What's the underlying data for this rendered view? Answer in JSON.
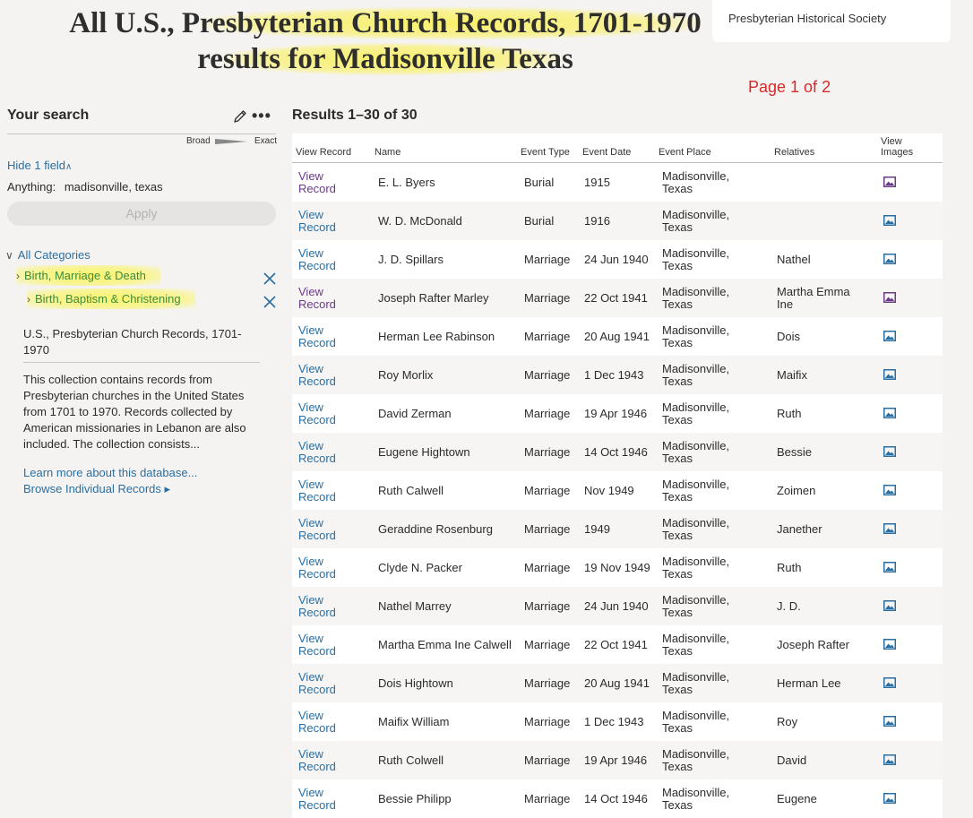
{
  "title": {
    "line1_pre": "All U.S., P",
    "line1_hl": "resbyterian Church Records, 1701-1970",
    "line2_pre": "re",
    "line2_hl": "sults for Madisonville Texa",
    "line2_post": "s"
  },
  "source": "Presbyterian Historical Society",
  "page_indicator": "Page 1 of 2",
  "sidebar": {
    "heading": "Your search",
    "slider_broad": "Broad",
    "slider_exact": "Exact",
    "hide_fields": "Hide 1 field",
    "anything_label": "Anything:",
    "anything_value": "madisonville, texas",
    "apply_label": "Apply",
    "all_categories": "All Categories",
    "category_1": "Birth, Marriage & Death",
    "category_2": "Birth, Baptism & Christening",
    "collection_title": "U.S., Presbyterian Church Records, 1701-1970",
    "collection_desc": "This collection contains records from Presbyterian churches in the United States from 1701 to 1970. Records collected by American missionaries in Lebanon are also included. The collection consists...",
    "learn_more": "Learn more about this database...",
    "browse": "Browse Individual Records ▸"
  },
  "results": {
    "heading": "Results 1–30 of 30",
    "columns": {
      "view_record": "View Record",
      "name": "Name",
      "event_type": "Event Type",
      "event_date": "Event Date",
      "event_place": "Event Place",
      "relatives": "Relatives",
      "view_images_1": "View",
      "view_images_2": "Images"
    },
    "view_line1": "View",
    "view_line2": "Record",
    "place_line1": "Madisonville,",
    "place_line2": "Texas",
    "rows": [
      {
        "name": "E. L. Byers",
        "type": "Burial",
        "date": "1915",
        "relatives": "",
        "visited": true
      },
      {
        "name": "W. D. McDonald",
        "type": "Burial",
        "date": "1916",
        "relatives": "",
        "visited": false
      },
      {
        "name": "J. D. Spillars",
        "type": "Marriage",
        "date": "24 Jun 1940",
        "relatives": "Nathel",
        "visited": false
      },
      {
        "name": "Joseph Rafter Marley",
        "type": "Marriage",
        "date": "22 Oct 1941",
        "relatives": "Martha Emma Ine",
        "visited": true
      },
      {
        "name": "Herman Lee Rabinson",
        "type": "Marriage",
        "date": "20 Aug 1941",
        "relatives": "Dois",
        "visited": false
      },
      {
        "name": "Roy Morlix",
        "type": "Marriage",
        "date": "1 Dec 1943",
        "relatives": "Maifix",
        "visited": false
      },
      {
        "name": "David Zerman",
        "type": "Marriage",
        "date": "19 Apr 1946",
        "relatives": "Ruth",
        "visited": false
      },
      {
        "name": "Eugene Hightown",
        "type": "Marriage",
        "date": "14 Oct 1946",
        "relatives": "Bessie",
        "visited": false
      },
      {
        "name": "Ruth Calwell",
        "type": "Marriage",
        "date": "Nov 1949",
        "relatives": "Zoimen",
        "visited": false
      },
      {
        "name": "Geraddine Rosenburg",
        "type": "Marriage",
        "date": "1949",
        "relatives": "Janether",
        "visited": false
      },
      {
        "name": "Clyde N. Packer",
        "type": "Marriage",
        "date": "19 Nov 1949",
        "relatives": "Ruth",
        "visited": false
      },
      {
        "name": "Nathel Marrey",
        "type": "Marriage",
        "date": "24 Jun 1940",
        "relatives": "J. D.",
        "visited": false
      },
      {
        "name": "Martha Emma Ine Calwell",
        "type": "Marriage",
        "date": "22 Oct 1941",
        "relatives": "Joseph Rafter",
        "visited": false
      },
      {
        "name": "Dois Hightown",
        "type": "Marriage",
        "date": "20 Aug 1941",
        "relatives": "Herman Lee",
        "visited": false
      },
      {
        "name": "Maifix William",
        "type": "Marriage",
        "date": "1 Dec 1943",
        "relatives": "Roy",
        "visited": false
      },
      {
        "name": "Ruth Colwell",
        "type": "Marriage",
        "date": "19 Apr 1946",
        "relatives": "David",
        "visited": false
      },
      {
        "name": "Bessie Philipp",
        "type": "Marriage",
        "date": "14 Oct 1946",
        "relatives": "Eugene",
        "visited": false
      }
    ]
  },
  "colors": {
    "link": "#2a6fa3",
    "visited_link": "#6b3b87",
    "page_indicator": "#d42a2a",
    "highlight": "#faf050"
  }
}
